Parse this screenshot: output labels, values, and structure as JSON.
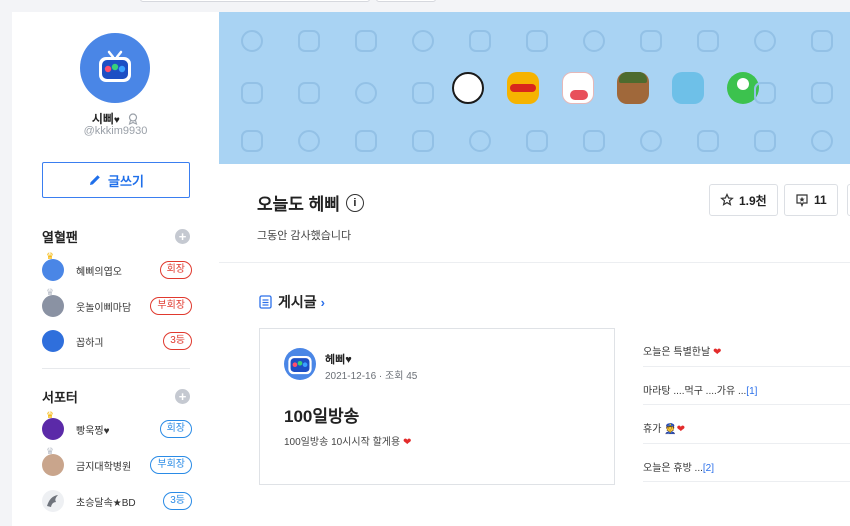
{
  "profile": {
    "nickname": "시삐",
    "nickname_heart": "♥",
    "user_id": "@kkkim9930"
  },
  "write_button": {
    "label": "글쓰기"
  },
  "fans": {
    "title": "열혈팬",
    "members": [
      {
        "name": "혜삐의엽오",
        "rank": "회장",
        "rank_color": "red",
        "crown": "gold"
      },
      {
        "name": "웃놀이삐마담",
        "rank": "부회장",
        "rank_color": "red",
        "crown": "silver"
      },
      {
        "name": "꼽하긔",
        "rank": "3등",
        "rank_color": "red",
        "crown": "none"
      }
    ]
  },
  "supporters": {
    "title": "서포터",
    "members": [
      {
        "name": "빵욱찡♥",
        "rank": "회장",
        "rank_color": "blue",
        "crown": "gold"
      },
      {
        "name": "금지대학병원",
        "rank": "부회장",
        "rank_color": "blue",
        "crown": "silver"
      },
      {
        "name": "초승달속★BD",
        "rank": "3등",
        "rank_color": "blue",
        "crown": "none"
      }
    ]
  },
  "station": {
    "title": "오늘도 헤삐",
    "info_icon": "i",
    "subtitle": "그동안 감사했습니다",
    "favorites": "1.9천",
    "fan_count": "11"
  },
  "board": {
    "title": "게시글",
    "chevron": "›"
  },
  "featured_post": {
    "author": "헤삐",
    "author_heart": "♥",
    "date": "2021-12-16",
    "views_label": "조회 45",
    "title": "100일방송",
    "body": "100일방송 10시시작 할게용"
  },
  "post_list": [
    {
      "title": "오늘은 특별한날",
      "suffix_heart": "❤",
      "comments": ""
    },
    {
      "title": "마라탕 ....먹구 ....가유 ...",
      "suffix_heart": "",
      "comments": "[1]"
    },
    {
      "title": "휴가",
      "suffix_heart": "❤",
      "comments": ""
    },
    {
      "title": "오늘은 휴방 ...",
      "suffix_heart": "",
      "comments": "[2]"
    }
  ],
  "colors": {
    "accent_blue": "#1f6fea",
    "banner_bg": "#a9d3f3",
    "rank_red": "#e0392e",
    "rank_blue": "#2a8be6",
    "heart_red": "#e32b2b"
  }
}
